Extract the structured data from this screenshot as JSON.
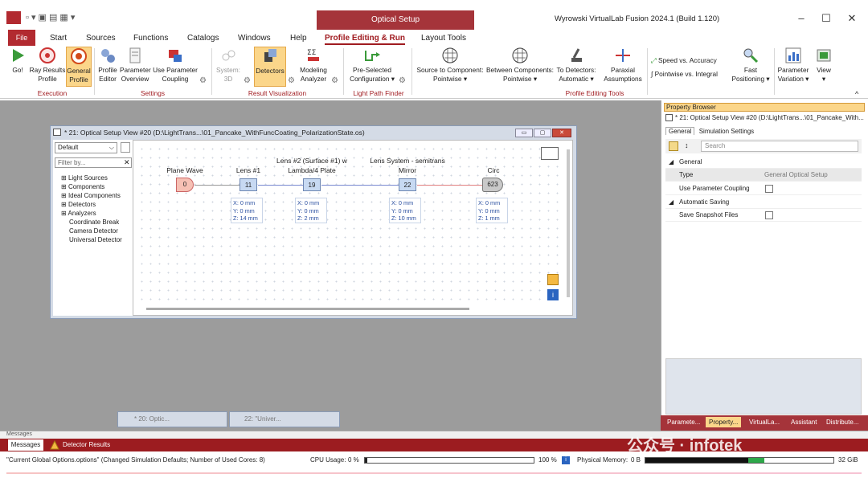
{
  "app": {
    "optical_tab": "Optical Setup",
    "title": "Wyrowski VirtualLab Fusion 2024.1 (Build 1.120)",
    "window_controls": [
      "–",
      "☐",
      "✕"
    ]
  },
  "menu": {
    "file": "File",
    "items": [
      "Start",
      "Sources",
      "Functions",
      "Catalogs",
      "Windows",
      "Help",
      "Profile Editing & Run",
      "Layout Tools"
    ]
  },
  "ribbon": {
    "go": "Go!",
    "ray_results_1": "Ray Results",
    "ray_results_2": "Profile",
    "general_1": "General",
    "general_2": "Profile",
    "profile_1": "Profile",
    "profile_2": "Editor",
    "parameter_1": "Parameter",
    "parameter_2": "Overview",
    "use_param_1": "Use Parameter",
    "use_param_2": "Coupling",
    "system_1": "System:",
    "system_2": "3D",
    "detectors": "Detectors",
    "modeling_1": "Modeling",
    "modeling_2": "Analyzer",
    "preselected_1": "Pre-Selected",
    "preselected_2": "Configuration ▾",
    "src_comp_1": "Source to Component:",
    "src_comp_2": "Pointwise ▾",
    "between_1": "Between Components:",
    "between_2": "Pointwise ▾",
    "to_det_1": "To Detectors:",
    "to_det_2": "Automatic ▾",
    "paraxial_1": "Paraxial",
    "paraxial_2": "Assumptions",
    "speed": "Speed vs. Accuracy",
    "pointwise_int": "Pointwise vs. Integral",
    "fast_1": "Fast",
    "fast_2": "Positioning ▾",
    "paramvar_1": "Parameter",
    "paramvar_2": "Variation ▾",
    "view_1": "View",
    "view_2": "▾",
    "groups": [
      "Execution",
      "Settings",
      "Result Visualization",
      "Light Path Finder",
      "Profile Editing Tools"
    ]
  },
  "property_browser": {
    "title": "Property Browser",
    "path": "* 21: Optical Setup View #20 (D:\\LightTrans...\\01_Pancake_With...",
    "tabs": [
      "General",
      "Simulation Settings"
    ],
    "search_placeholder": "Search",
    "section_general": "General",
    "type_key": "Type",
    "type_value": "General Optical Setup",
    "use_param_coupling": "Use Parameter Coupling",
    "section_auto": "Automatic Saving",
    "save_snapshot": "Save Snapshot Files",
    "bottom_tabs": [
      "Paramete...",
      "Property...",
      "VirtualLa...",
      "Assistant",
      "Distribute..."
    ]
  },
  "mdi": {
    "title": "* 21: Optical Setup View #20 (D:\\LightTrans...\\01_Pancake_WithFuncCoating_PolarizationState.os)",
    "dropdown": "Default",
    "filter": "Filter by...",
    "tree": [
      "Light Sources",
      "Components",
      "Ideal Components",
      "Detectors",
      "Analyzers"
    ],
    "tree_leaves": [
      "Coordinate Break",
      "Camera Detector",
      "Universal Detector"
    ]
  },
  "setup": {
    "nodes": [
      {
        "label": "Plane Wave",
        "id": "0"
      },
      {
        "label": "Lens #1",
        "id": "11",
        "x": "X: 0 mm",
        "y": "Y: 0 mm",
        "z": "Z: 14 mm"
      },
      {
        "label": "Lens #2 (Surface #1) w",
        "label2": "Lambda/4 Plate",
        "id": "19",
        "x": "X: 0 mm",
        "y": "Y: 0 mm",
        "z": "Z: 2 mm"
      },
      {
        "label": "Lens System - semitrans",
        "label2": "Mirror",
        "id": "22",
        "x": "X: 0 mm",
        "y": "Y: 0 mm",
        "z": "Z: 10 mm"
      },
      {
        "label": "Circ",
        "id": "623",
        "x": "X: 0 mm",
        "y": "Y: 0 mm",
        "z": "Z: 1 mm"
      }
    ]
  },
  "minimized": [
    "* 20: Optic...",
    "22: \"Univer..."
  ],
  "messages": {
    "header": "Messages",
    "tab1": "Messages",
    "tab2": "Detector Results"
  },
  "status": {
    "options": "\"Current Global Options.options\" (Changed Simulation Defaults; Number of Used Cores: 8)",
    "cpu_label": "CPU Usage:",
    "cpu_value": "0 %",
    "cpu_max": "100 %",
    "mem_label": "Physical Memory:",
    "mem_value": "0 B",
    "mem_max": "32 GiB"
  },
  "watermark": "公众号 · infotek",
  "colors": {
    "accent": "#a5343a",
    "highlight": "#fbd68a",
    "node": "#c7d9f2"
  }
}
